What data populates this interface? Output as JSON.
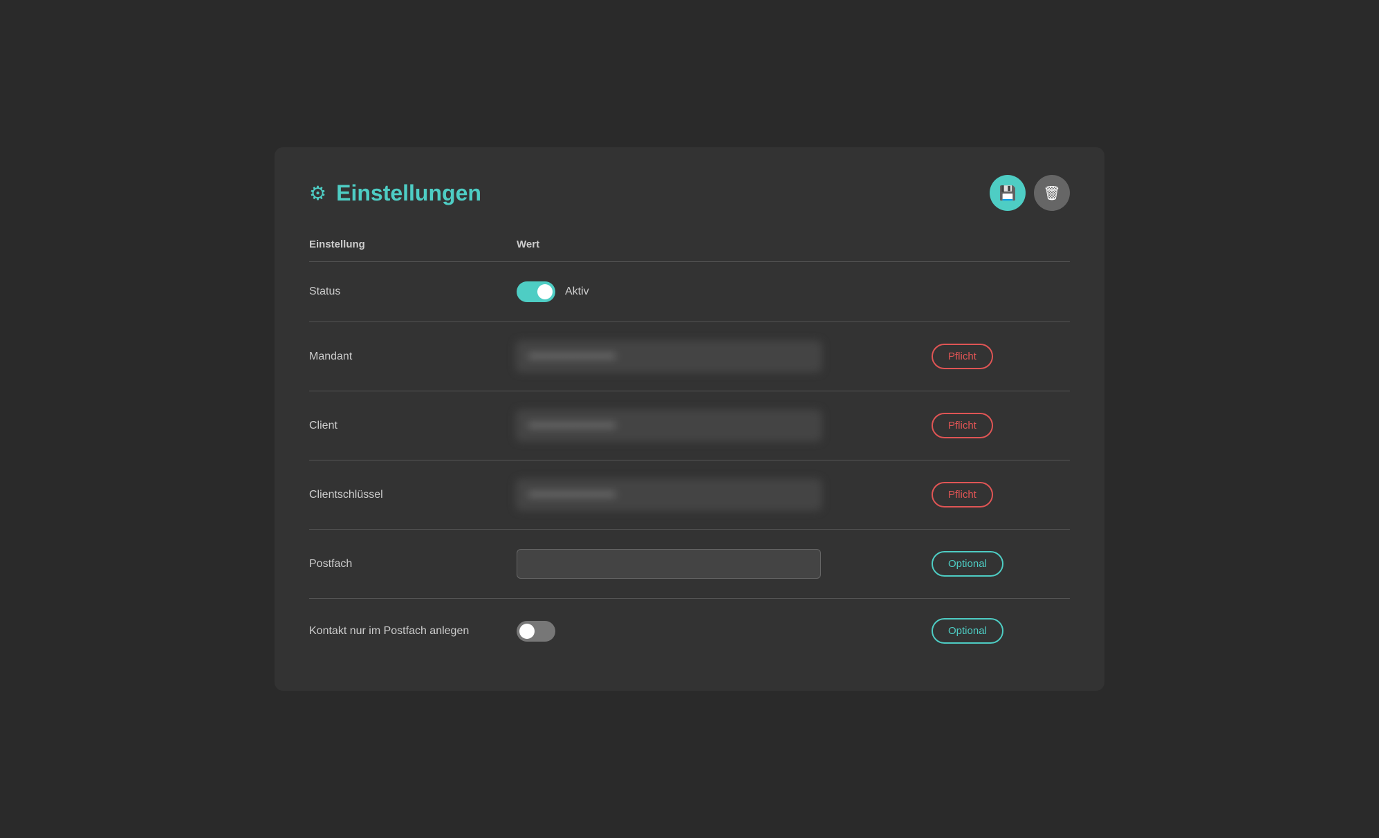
{
  "page": {
    "title": "Einstellungen",
    "gear_icon": "⚙",
    "save_icon": "💾",
    "delete_icon": "🗑"
  },
  "table": {
    "col_setting": "Einstellung",
    "col_value": "Wert"
  },
  "rows": [
    {
      "id": "status",
      "label": "Status",
      "type": "toggle",
      "toggle_on": true,
      "toggle_label": "Aktiv",
      "badge": null
    },
    {
      "id": "mandant",
      "label": "Mandant",
      "type": "input",
      "value": "••••••••••••••••••••",
      "blurred": true,
      "badge": "Pflicht",
      "badge_type": "pflicht"
    },
    {
      "id": "client",
      "label": "Client",
      "type": "input",
      "value": "••••••••••••••••••••••••",
      "blurred": true,
      "badge": "Pflicht",
      "badge_type": "pflicht"
    },
    {
      "id": "clientschluessel",
      "label": "Clientschlüssel",
      "type": "input",
      "value": "••••••••••••••••••••",
      "blurred": true,
      "badge": "Pflicht",
      "badge_type": "pflicht"
    },
    {
      "id": "postfach",
      "label": "Postfach",
      "type": "input",
      "value": "",
      "blurred": false,
      "badge": "Optional",
      "badge_type": "optional"
    },
    {
      "id": "kontakt",
      "label": "Kontakt nur im Postfach anlegen",
      "type": "toggle",
      "toggle_on": false,
      "toggle_label": "",
      "badge": "Optional",
      "badge_type": "optional"
    }
  ]
}
